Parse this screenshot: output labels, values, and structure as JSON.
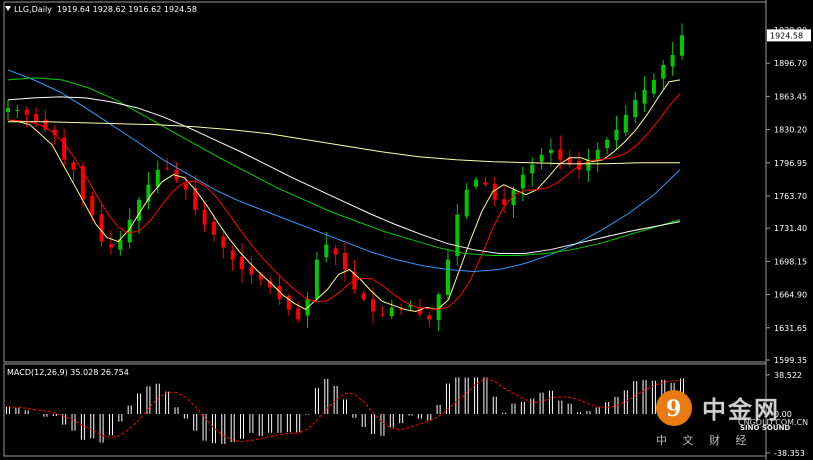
{
  "header": {
    "symbol": "LLG,Daily",
    "ohlc": "1919.64 1928.62 1916.62 1924.58"
  },
  "macd_header": "MACD(12,26,9) 35.028 26.754",
  "watermark": {
    "brand": "中金网",
    "url": "CNGOLD.COM.CN",
    "tagline": "中 文 财 经",
    "partner": "SINO SOUND",
    "logo_glyph": "9"
  },
  "price_axis": {
    "ticks": [
      "1929.90",
      "1896.70",
      "1863.45",
      "1830.20",
      "1796.95",
      "1763.70",
      "1731.40",
      "1698.15",
      "1664.90",
      "1631.65",
      "1599.35"
    ],
    "current": "1924.58"
  },
  "macd_axis": {
    "ticks": [
      "38.522",
      "0.00",
      "-38.353"
    ]
  },
  "colors": {
    "up": "#ffffff",
    "down": "#ff0000",
    "up_candle": "#00c800",
    "down_candle": "#ff0000",
    "ma5": "#ffff80",
    "ma10": "#ff0000",
    "ma20": "#3399ff",
    "ma60": "#00cc00",
    "ma120": "#ffffff",
    "ma250": "#ffffaa",
    "macd_hist": "#ffffff",
    "macd_signal": "#ff0000"
  },
  "chart_data": {
    "type": "candlestick",
    "title": "LLG,Daily",
    "ylim": [
      1599.35,
      1940
    ],
    "ohlc_last": {
      "open": 1919.64,
      "high": 1928.62,
      "low": 1916.62,
      "close": 1924.58
    },
    "close_path": [
      1852,
      1850,
      1845,
      1838,
      1830,
      1825,
      1800,
      1790,
      1760,
      1745,
      1718,
      1712,
      1720,
      1740,
      1760,
      1775,
      1790,
      1792,
      1780,
      1770,
      1750,
      1735,
      1725,
      1712,
      1700,
      1690,
      1685,
      1680,
      1672,
      1660,
      1650,
      1640,
      1660,
      1700,
      1715,
      1705,
      1690,
      1670,
      1660,
      1648,
      1645,
      1652,
      1650,
      1655,
      1645,
      1640,
      1665,
      1700,
      1745,
      1770,
      1780,
      1775,
      1760,
      1755,
      1770,
      1785,
      1795,
      1805,
      1810,
      1800,
      1795,
      1790,
      1800,
      1810,
      1820,
      1830,
      1845,
      1860,
      1870,
      1880,
      1895,
      1905,
      1924.58
    ],
    "moving_averages": [
      {
        "period": 5,
        "values": [
          1840,
          1838,
          1835,
          1825,
          1815,
          1795,
          1775,
          1755,
          1735,
          1722,
          1718,
          1730,
          1748,
          1765,
          1778,
          1785,
          1782,
          1770,
          1755,
          1738,
          1722,
          1708,
          1696,
          1685,
          1675,
          1664,
          1656,
          1650,
          1660,
          1670,
          1685,
          1690,
          1680,
          1668,
          1658,
          1654,
          1650,
          1648,
          1652,
          1650,
          1660,
          1690,
          1720,
          1748,
          1768,
          1775,
          1770,
          1765,
          1770,
          1782,
          1795,
          1802,
          1802,
          1798,
          1800,
          1808,
          1818,
          1830,
          1845,
          1862,
          1878,
          1880
        ]
      },
      {
        "period": 120,
        "values": [
          1860,
          1862,
          1863,
          1862,
          1858,
          1852,
          1843,
          1832,
          1820,
          1808,
          1795,
          1782,
          1770,
          1758,
          1746,
          1735,
          1725,
          1716,
          1710,
          1706,
          1706,
          1710,
          1716,
          1722,
          1728,
          1733,
          1738
        ]
      },
      {
        "period": 250,
        "values": [
          1838,
          1838,
          1837,
          1836,
          1835,
          1833,
          1830,
          1826,
          1820,
          1814,
          1808,
          1803,
          1800,
          1798,
          1797,
          1796,
          1796,
          1797,
          1797
        ]
      }
    ],
    "macd": {
      "params": "12,26,9",
      "macd": 35.028,
      "signal": 26.754,
      "ylim": [
        -38.353,
        38.522
      ]
    }
  }
}
